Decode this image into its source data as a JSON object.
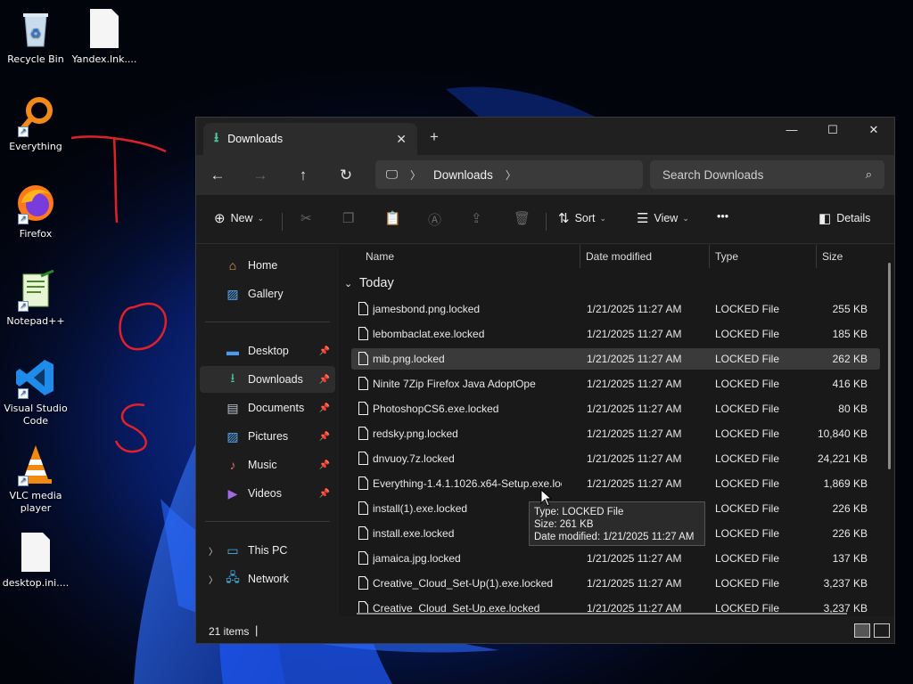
{
  "desktop": {
    "icons": [
      {
        "label": "Recycle Bin"
      },
      {
        "label": "Yandex.lnk...."
      },
      {
        "label": "Everything"
      },
      {
        "label": "Firefox"
      },
      {
        "label": "Notepad++"
      },
      {
        "label": "Visual Studio Code"
      },
      {
        "label": "VLC media player"
      },
      {
        "label": "desktop.ini...."
      }
    ]
  },
  "window": {
    "tab_title": "Downloads",
    "new_tab": "+",
    "controls": {
      "minimize": "—",
      "maximize": "☐",
      "close": "✕"
    },
    "address": {
      "folder": "Downloads"
    },
    "search": {
      "placeholder": "Search Downloads"
    },
    "commands": {
      "new": "New",
      "sort": "Sort",
      "view": "View",
      "more": "•••",
      "details": "Details"
    },
    "sidebar": {
      "items": [
        {
          "label": "Home"
        },
        {
          "label": "Gallery"
        },
        {
          "label": "Desktop"
        },
        {
          "label": "Downloads"
        },
        {
          "label": "Documents"
        },
        {
          "label": "Pictures"
        },
        {
          "label": "Music"
        },
        {
          "label": "Videos"
        },
        {
          "label": "This PC"
        },
        {
          "label": "Network"
        }
      ]
    },
    "columns": {
      "name": "Name",
      "date": "Date modified",
      "type": "Type",
      "size": "Size"
    },
    "group": "Today",
    "files": [
      {
        "name": "jamesbond.png.locked",
        "date": "1/21/2025 11:27 AM",
        "type": "LOCKED File",
        "size": "255 KB"
      },
      {
        "name": "lebombaclat.exe.locked",
        "date": "1/21/2025 11:27 AM",
        "type": "LOCKED File",
        "size": "185 KB"
      },
      {
        "name": "mib.png.locked",
        "date": "1/21/2025 11:27 AM",
        "type": "LOCKED File",
        "size": "262 KB"
      },
      {
        "name": "Ninite 7Zip Firefox Java AdoptOpe",
        "date": "1/21/2025 11:27 AM",
        "type": "LOCKED File",
        "size": "416 KB"
      },
      {
        "name": "PhotoshopCS6.exe.locked",
        "date": "1/21/2025 11:27 AM",
        "type": "LOCKED File",
        "size": "80 KB"
      },
      {
        "name": "redsky.png.locked",
        "date": "1/21/2025 11:27 AM",
        "type": "LOCKED File",
        "size": "10,840 KB"
      },
      {
        "name": "dnvuoy.7z.locked",
        "date": "1/21/2025 11:27 AM",
        "type": "LOCKED File",
        "size": "24,221 KB"
      },
      {
        "name": "Everything-1.4.1.1026.x64-Setup.exe.locked",
        "date": "1/21/2025 11:27 AM",
        "type": "LOCKED File",
        "size": "1,869 KB"
      },
      {
        "name": "install(1).exe.locked",
        "date": "1/21/2025 11:27 AM",
        "type": "LOCKED File",
        "size": "226 KB"
      },
      {
        "name": "install.exe.locked",
        "date": "1/21/2025 11:27 AM",
        "type": "LOCKED File",
        "size": "226 KB"
      },
      {
        "name": "jamaica.jpg.locked",
        "date": "1/21/2025 11:27 AM",
        "type": "LOCKED File",
        "size": "137 KB"
      },
      {
        "name": "Creative_Cloud_Set-Up(1).exe.locked",
        "date": "1/21/2025 11:27 AM",
        "type": "LOCKED File",
        "size": "3,237 KB"
      },
      {
        "name": "Creative_Cloud_Set-Up.exe.locked",
        "date": "1/21/2025 11:27 AM",
        "type": "LOCKED File",
        "size": "3,237 KB"
      }
    ],
    "tooltip": {
      "line1": "Type: LOCKED File",
      "line2": "Size: 261 KB",
      "line3": "Date modified: 1/21/2025 11:27 AM"
    },
    "status": {
      "count": "21 items",
      "caret": "|"
    }
  }
}
